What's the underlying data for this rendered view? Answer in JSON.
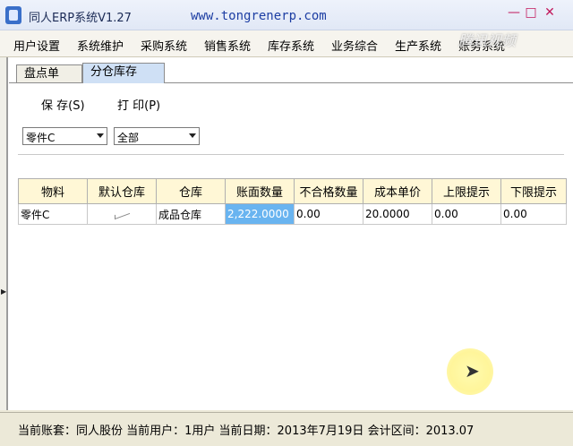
{
  "window": {
    "title": "同人ERP系统V1.27",
    "url": "www.tongrenerp.com",
    "controls": [
      "—",
      "□",
      "✕"
    ]
  },
  "menu": [
    "用户设置",
    "系统维护",
    "采购系统",
    "销售系统",
    "库存系统",
    "业务综合",
    "生产系统",
    "账务系统"
  ],
  "watermark": "腾讯视频",
  "tabs": [
    {
      "label": "盘点单",
      "active": false
    },
    {
      "label": "分仓库存",
      "active": true
    }
  ],
  "toolbar": {
    "save": "保 存(S)",
    "print": "打 印(P)"
  },
  "filters": {
    "part": "零件C",
    "scope": "全部"
  },
  "grid": {
    "headers": [
      "物料",
      "默认仓库",
      "仓库",
      "账面数量",
      "不合格数量",
      "成本单价",
      "上限提示",
      "下限提示"
    ],
    "rows": [
      {
        "material": "零件C",
        "default_warehouse_checked": true,
        "warehouse": "成品仓库",
        "book_qty": "2,222.0000",
        "defect_qty": "0.00",
        "unit_cost": "20.0000",
        "upper_limit": "0.00",
        "lower_limit": "0.00"
      }
    ]
  },
  "status": "当前账套：同人股份  当前用户：1用户  当前日期：2013年7月19日  会计区间：2013.07"
}
